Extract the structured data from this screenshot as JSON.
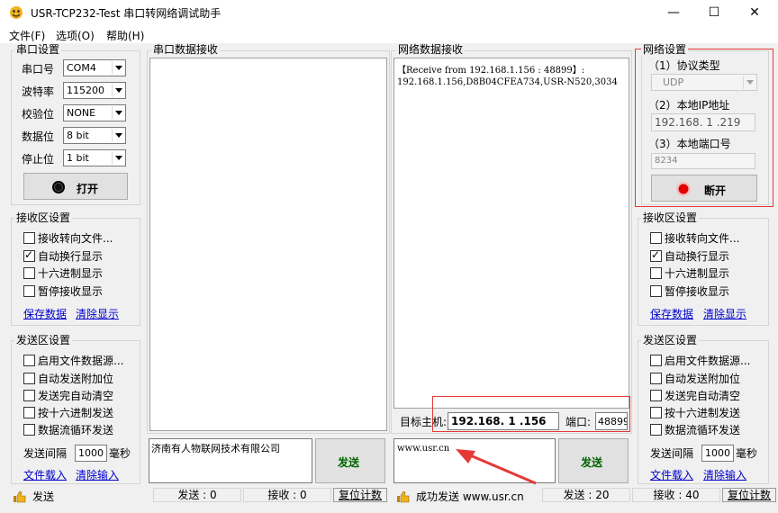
{
  "window": {
    "title": "USR-TCP232-Test 串口转网络调试助手",
    "minimize": "—",
    "maximize": "☐",
    "close": "✕"
  },
  "menu": {
    "file": "文件(F)",
    "options": "选项(O)",
    "help": "帮助(H)"
  },
  "serial_settings": {
    "title": "串口设置",
    "port_label": "串口号",
    "port_value": "COM4",
    "baud_label": "波特率",
    "baud_value": "115200",
    "parity_label": "校验位",
    "parity_value": "NONE",
    "data_label": "数据位",
    "data_value": "8 bit",
    "stop_label": "停止位",
    "stop_value": "1 bit",
    "open_button": "打开"
  },
  "left_receive": {
    "title": "接收区设置",
    "opt1": "接收转向文件...",
    "opt2": "自动换行显示",
    "opt3": "十六进制显示",
    "opt4": "暂停接收显示",
    "save": "保存数据",
    "clear": "清除显示"
  },
  "left_send": {
    "title": "发送区设置",
    "opt1": "启用文件数据源...",
    "opt2": "自动发送附加位",
    "opt3": "发送完自动清空",
    "opt4": "按十六进制发送",
    "opt5": "数据流循环发送",
    "interval_label": "发送间隔",
    "interval_value": "1000",
    "interval_unit": "毫秒",
    "load": "文件载入",
    "clear": "清除输入"
  },
  "serial_receive": {
    "title": "串口数据接收"
  },
  "serial_send": {
    "text": "济南有人物联网技术有限公司",
    "button": "发送"
  },
  "net_receive": {
    "title": "网络数据接收",
    "line1": "【Receive from 192.168.1.156 : 48899】:",
    "line2": "192.168.1.156,D8B04CFEA734,USR-N520,3034"
  },
  "target": {
    "host_label": "目标主机:",
    "host_value": "192.168. 1 .156",
    "port_label": "端口:",
    "port_value": "48899"
  },
  "net_send": {
    "text": "www.usr.cn",
    "button": "发送"
  },
  "net_settings": {
    "title": "网络设置",
    "proto_label": "（1）协议类型",
    "proto_value": "UDP",
    "ip_label": "（2）本地IP地址",
    "ip_value": "192.168. 1 .219",
    "port_label": "（3）本地端口号",
    "port_value": "8234",
    "disconnect_button": "断开"
  },
  "right_receive": {
    "title": "接收区设置",
    "opt1": "接收转向文件...",
    "opt2": "自动换行显示",
    "opt3": "十六进制显示",
    "opt4": "暂停接收显示",
    "save": "保存数据",
    "clear": "清除显示"
  },
  "right_send": {
    "title": "发送区设置",
    "opt1": "启用文件数据源...",
    "opt2": "自动发送附加位",
    "opt3": "发送完自动清空",
    "opt4": "按十六进制发送",
    "opt5": "数据流循环发送",
    "interval_label": "发送间隔",
    "interval_value": "1000",
    "interval_unit": "毫秒",
    "load": "文件载入",
    "clear": "清除输入"
  },
  "status_left": {
    "state": "发送",
    "sent": "发送 : 0",
    "recv": "接收 : 0",
    "reset": "复位计数"
  },
  "status_right": {
    "state": "成功发送 www.usr.cn",
    "sent": "发送 : 20",
    "recv": "接收 : 40",
    "reset": "复位计数"
  },
  "colors": {
    "annotation_red": "#e53935",
    "link_blue": "#0000cc",
    "led_red": "#e00000"
  }
}
